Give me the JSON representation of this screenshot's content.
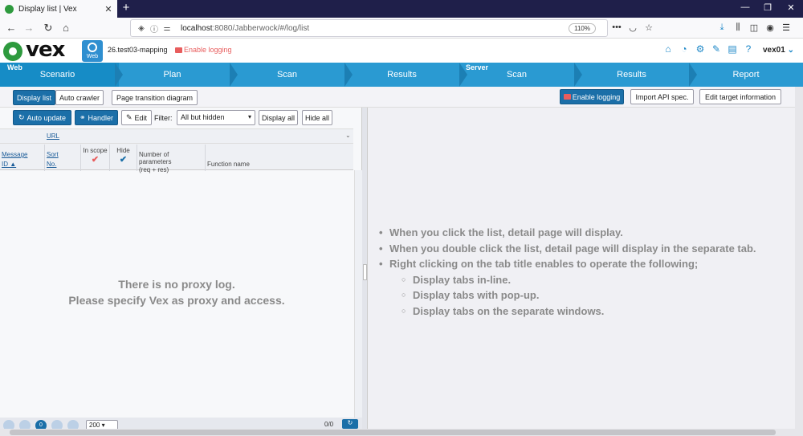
{
  "browser": {
    "tab_title": "Display list | Vex",
    "url_host": "localhost",
    "url_rest": ":8080/Jabberwock/#/log/list",
    "zoom": "110%"
  },
  "header": {
    "logo_text": "vex",
    "badge_label": "Web",
    "project": "26.test03-mapping",
    "enable_logging": "Enable logging",
    "user": "vex01"
  },
  "steps": {
    "web_label": "Web",
    "server_label": "Server",
    "items": [
      "Scenario",
      "Plan",
      "Scan",
      "Results",
      "Scan",
      "Results",
      "Report"
    ]
  },
  "toolbar": {
    "display_list": "Display list",
    "auto_crawler": "Auto crawler",
    "page_transition": "Page transition diagram",
    "enable_logging": "Enable logging",
    "import_api": "Import API spec.",
    "edit_target": "Edit target information"
  },
  "list_toolbar": {
    "auto_update": "Auto update",
    "handler": "Handler",
    "edit": "Edit",
    "filter_label": "Filter:",
    "filter_value": "All but hidden",
    "display_all": "Display all",
    "hide_all": "Hide all"
  },
  "table": {
    "url_col": "URL",
    "cols": {
      "message_id_1": "Message",
      "message_id_2": "ID ▲",
      "sort_1": "Sort",
      "sort_2": "No.",
      "in_scope": "In scope",
      "hide": "Hide",
      "num_params_1": "Number of parameters",
      "num_params_2": "(req + res)",
      "function_name": "Function name"
    },
    "empty_1": "There is no proxy log.",
    "empty_2": "Please specify Vex as proxy and access."
  },
  "pager": {
    "current": "0",
    "page_size": "200",
    "count": "0/0"
  },
  "hints": [
    "When you click the list, detail page will display.",
    "When you double click the list, detail page will display in the separate tab.",
    "Right clicking on the tab title enables to operate the following;"
  ],
  "sub_hints": [
    "Display tabs in-line.",
    "Display tabs with pop-up.",
    "Display tabs on the separate windows."
  ],
  "colors": {
    "step_bar": "#2a9ad2",
    "button_blue": "#1b6fa8",
    "logging_red": "#e85d5d",
    "logo_green": "#2e9a3e"
  }
}
